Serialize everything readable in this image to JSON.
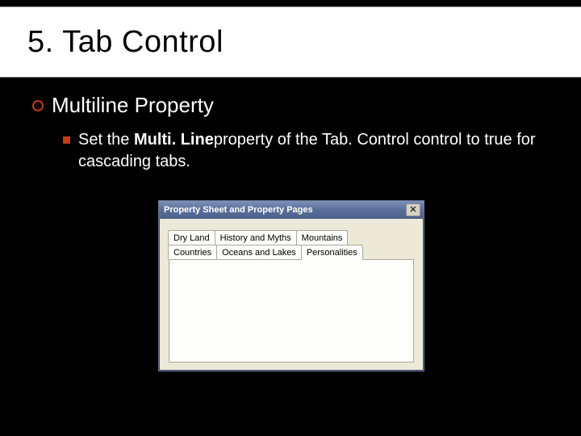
{
  "slide": {
    "title": "5. Tab Control",
    "heading": "Multiline Property",
    "body_prefix": "Set the ",
    "body_bold": "Multi. Line",
    "body_suffix": "property of the Tab. Control control to true for cascading tabs."
  },
  "window": {
    "title": "Property Sheet and Property Pages",
    "tabs_row1": [
      "Dry Land",
      "History and Myths",
      "Mountains"
    ],
    "tabs_row2": [
      "Countries",
      "Oceans and Lakes",
      "Personalities"
    ],
    "active_tab": "Personalities"
  }
}
